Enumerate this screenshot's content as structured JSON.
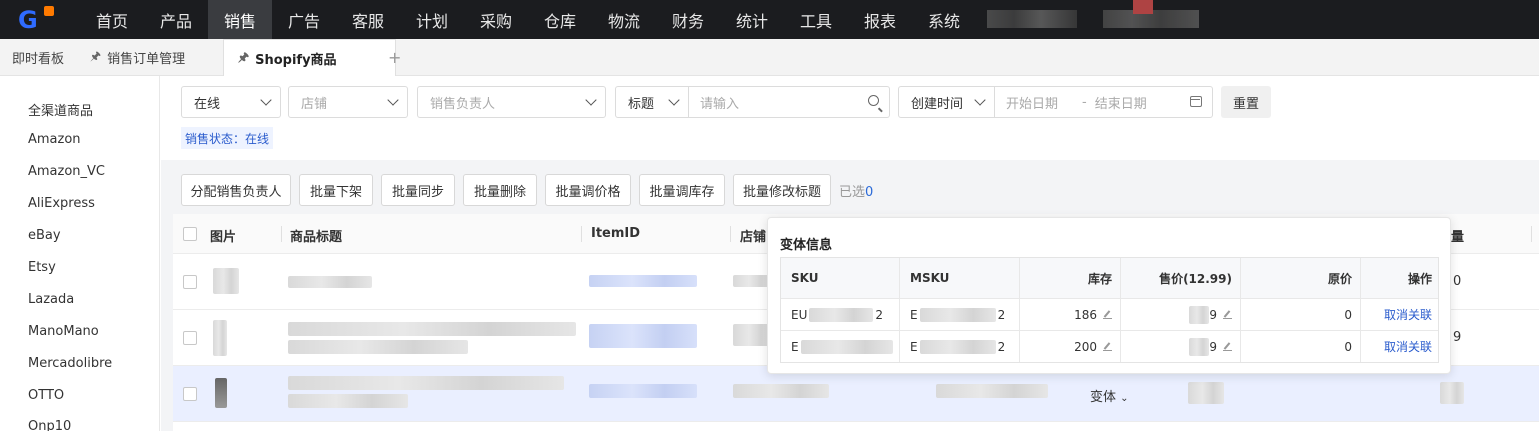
{
  "topnav": {
    "logo": "G",
    "items": [
      "首页",
      "产品",
      "销售",
      "广告",
      "客服",
      "计划",
      "采购",
      "仓库",
      "物流",
      "财务",
      "统计",
      "工具",
      "报表",
      "系统"
    ],
    "active_index": 2
  },
  "tabs": {
    "items": [
      {
        "label": "即时看板"
      },
      {
        "label": "销售订单管理"
      },
      {
        "label": "Shopify商品"
      }
    ],
    "add": "+"
  },
  "sidebar": {
    "items": [
      "全渠道商品",
      "Amazon",
      "Amazon_VC",
      "AliExpress",
      "eBay",
      "Etsy",
      "Lazada",
      "ManoMano",
      "Mercadolibre",
      "OTTO",
      "Onp10"
    ]
  },
  "filters": {
    "status_value": "在线",
    "store_placeholder": "店铺",
    "owner_placeholder": "销售负责人",
    "search_field": "标题",
    "search_placeholder": "请输入",
    "date_field": "创建时间",
    "start_placeholder": "开始日期",
    "date_sep": "-",
    "end_placeholder": "结束日期",
    "reset": "重置",
    "status_tag": "销售状态：在线"
  },
  "toolbar": {
    "buttons": [
      "分配销售负责人",
      "批量下架",
      "批量同步",
      "批量删除",
      "批量调价格",
      "批量调库存",
      "批量修改标题"
    ],
    "selected_label": "已选",
    "selected_count": "0"
  },
  "table": {
    "headers": {
      "image": "图片",
      "title": "商品标题",
      "item_id": "ItemID",
      "store": "店铺",
      "qty": "量"
    },
    "variant_label": "变体",
    "row_partial_values": [
      "0",
      "9"
    ]
  },
  "popover": {
    "title": "变体信息",
    "columns": [
      "SKU",
      "MSKU",
      "库存",
      "售价(12.99)",
      "原价",
      "操作"
    ],
    "rows": [
      {
        "sku": "EU",
        "sku_tail": "2",
        "msku": "E",
        "msku_tail": "2",
        "stock": "186",
        "price": "9",
        "orig": "0",
        "action": "取消关联"
      },
      {
        "sku": "E",
        "sku_tail": "",
        "msku": "E",
        "msku_tail": "2",
        "stock": "200",
        "price": "9",
        "orig": "0",
        "action": "取消关联"
      }
    ]
  }
}
